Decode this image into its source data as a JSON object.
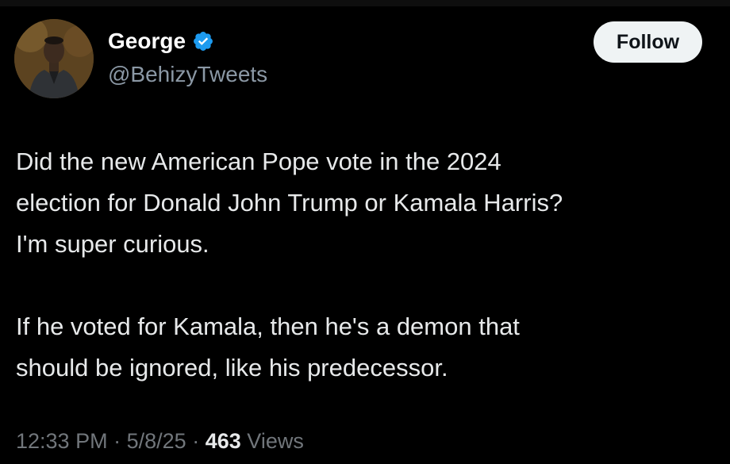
{
  "author": {
    "display_name": "George",
    "handle": "@BehizyTweets",
    "verified_icon": "verified-badge-icon",
    "avatar": "profile-photo"
  },
  "follow_button": {
    "label": "Follow"
  },
  "tweet": {
    "paragraph_1_line_1": "Did the new American Pope vote in the 2024",
    "paragraph_1_line_2": "election for Donald John Trump or Kamala Harris?",
    "paragraph_1_line_3": "I'm super curious.",
    "paragraph_2_line_1": "If he voted for Kamala, then he's a demon that",
    "paragraph_2_line_2": "should be ignored, like his predecessor."
  },
  "meta": {
    "time": "12:33 PM",
    "separator": "·",
    "date": "5/8/25",
    "views_count": "463",
    "views_label": "Views"
  },
  "colors": {
    "background": "#000000",
    "text": "#e7e9ea",
    "secondary_text": "#71767b",
    "verified_blue": "#1d9bf0",
    "follow_button_bg": "#eff3f4"
  }
}
